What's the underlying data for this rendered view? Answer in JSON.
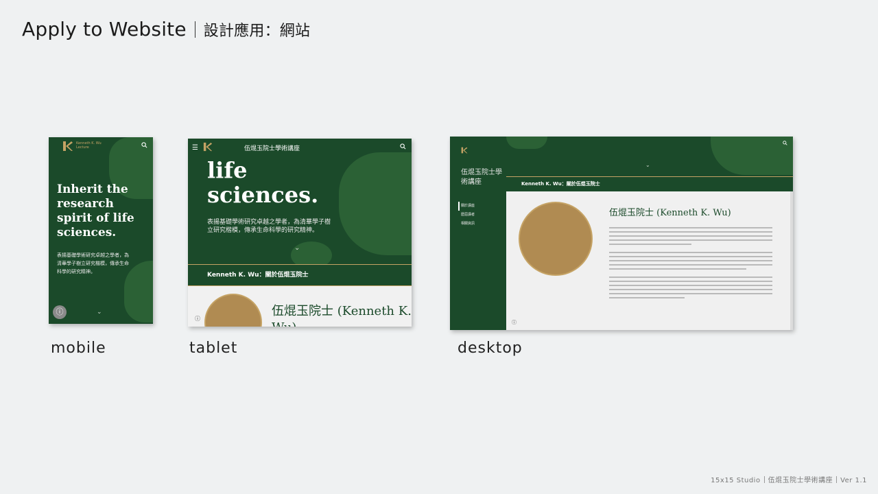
{
  "header": {
    "title_en": "Apply to Website",
    "title_zh": "設計應用：網站"
  },
  "labels": {
    "mobile": "mobile",
    "tablet": "tablet",
    "desktop": "desktop"
  },
  "footer": {
    "studio": "15x15 Studio",
    "project": "伍焜玉院士學術講座",
    "version": "Ver 1.1"
  },
  "site": {
    "brand": "Kenneth K. Wu Lecture",
    "hero_lines_mobile": "Inherit the research spirit of life sciences.",
    "hero_lines_tablet": "life sciences.",
    "subtitle": "表揚基礎學術研究卓越之學者，為清華學子樹立研究楷模，傳承生命科學的研究精神。",
    "nav_title": "伍焜玉院士學術講座",
    "section_band": "Kenneth K. Wu：關於伍焜玉院士",
    "person_name_tablet": "伍焜玉院士 (Kenneth K. Wu)",
    "person_name_desktop": "伍焜玉院士 (Kenneth K. Wu)",
    "side_title": "伍焜玉院士學術講座",
    "side_nav": [
      "關於講座",
      "歷屆講者",
      "相關資訊"
    ],
    "colors": {
      "primary_green": "#1b4a2a",
      "gold": "#c5a365",
      "light": "#f0f0f0"
    }
  }
}
